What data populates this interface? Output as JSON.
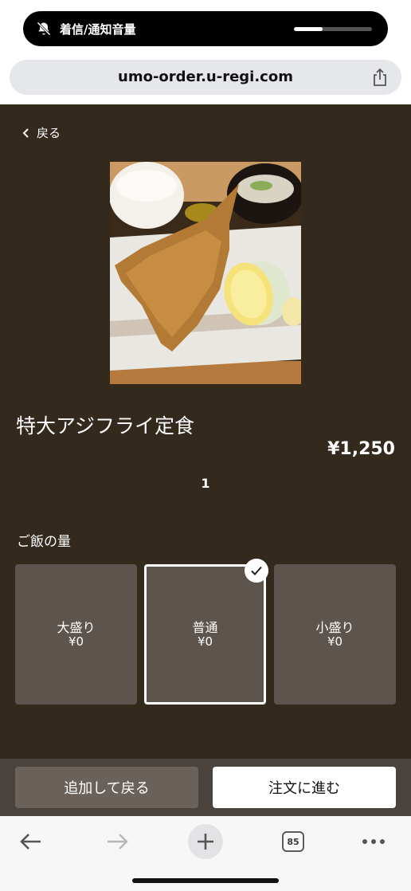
{
  "system": {
    "status_text": "着信/通知音量",
    "volume_level": 0.37
  },
  "browser": {
    "url": "umo-order.u-regi.com",
    "tab_count": "85"
  },
  "page": {
    "back_label": "戻る",
    "item_name": "特大アジフライ定食",
    "price": "¥1,250",
    "quantity": "1",
    "option_heading": "ご飯の量",
    "options": [
      {
        "label": "大盛り",
        "price": "¥0",
        "selected": false
      },
      {
        "label": "普通",
        "price": "¥0",
        "selected": true
      },
      {
        "label": "小盛り",
        "price": "¥0",
        "selected": false
      }
    ]
  },
  "actions": {
    "add_and_back": "追加して戻る",
    "proceed_to_order": "注文に進む"
  },
  "colors": {
    "page_background": "#33291c",
    "option_card": "#5d544e",
    "action_bar": "#4a423d"
  }
}
